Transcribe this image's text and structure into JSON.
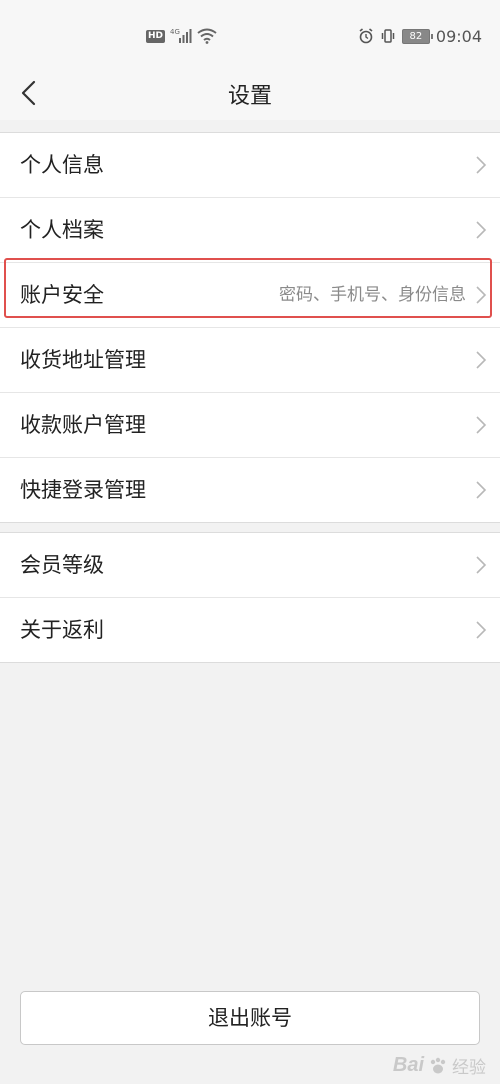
{
  "status_bar": {
    "hd_label": "HD",
    "network_label": "4G",
    "battery_level": "82",
    "time": "09:04"
  },
  "nav": {
    "title": "设置"
  },
  "group1": [
    {
      "label": "个人信息",
      "sub": ""
    },
    {
      "label": "个人档案",
      "sub": ""
    },
    {
      "label": "账户安全",
      "sub": "密码、手机号、身份信息"
    },
    {
      "label": "收货地址管理",
      "sub": ""
    },
    {
      "label": "收款账户管理",
      "sub": ""
    },
    {
      "label": "快捷登录管理",
      "sub": ""
    }
  ],
  "group2": [
    {
      "label": "会员等级",
      "sub": ""
    },
    {
      "label": "关于返利",
      "sub": ""
    }
  ],
  "logout_label": "退出账号",
  "watermark": {
    "brand": "Bai",
    "suffix": "经验"
  },
  "colors": {
    "background": "#f2f2f2",
    "highlight": "#e0504d",
    "subtext": "#8a8a8a"
  }
}
